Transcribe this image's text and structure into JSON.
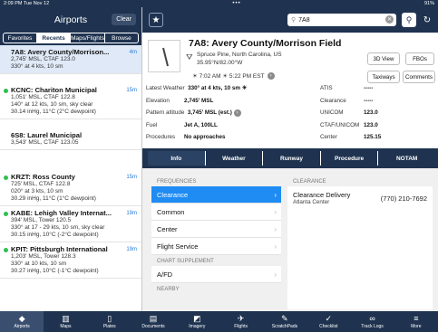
{
  "status": {
    "time": "2:09 PM  Tue Nov 12",
    "dots": "•••",
    "battery": "91%"
  },
  "left": {
    "title": "Airports",
    "clear_label": "Clear",
    "segments": [
      "Favorites",
      "Recents",
      "Maps/Flights",
      "Browse"
    ],
    "airports": [
      {
        "name": "7A8: Avery County/Morrison...",
        "dist": "4m",
        "l1": "2,745' MSL, CTAF 123.0",
        "l2": "330° at 4 kts, 10 sm",
        "l3": "",
        "l4": "",
        "dot": false,
        "selected": true
      },
      {
        "name": "KCNC: Chariton Municipal",
        "dist": "15m",
        "l1": "1,051' MSL, CTAF 122.8",
        "l2": "140° at 12 kts, 10 sm, sky clear",
        "l3": "30.14 inHg, 11°C (2°C dewpoint)",
        "l4": "",
        "dot": true,
        "selected": false
      },
      {
        "name": "6S8: Laurel Municipal",
        "dist": "",
        "l1": "3,543' MSL, CTAF 123.05",
        "l2": "",
        "l3": "",
        "l4": "",
        "dot": false,
        "selected": false
      },
      {
        "name": "KRZT: Ross County",
        "dist": "15m",
        "l1": "725' MSL, CTAF 122.8",
        "l2": "020° at 3 kts, 10 sm",
        "l3": "30.29 inHg, 11°C (1°C dewpoint)",
        "l4": "",
        "dot": true,
        "selected": false
      },
      {
        "name": "KABE: Lehigh Valley Internat...",
        "dist": "19m",
        "l1": "394' MSL, Tower 120.5",
        "l2": "330° at 17 - 29 kts, 10 sm, sky clear",
        "l3": "30.15 inHg, 10°C (-2°C dewpoint)",
        "l4": "",
        "dot": true,
        "selected": false
      },
      {
        "name": "KPIT: Pittsburgh International",
        "dist": "19m",
        "l1": "1,203' MSL, Tower 128.3",
        "l2": "330° at 10 kts, 10 sm",
        "l3": "30.27 inHg, 10°C (-1°C dewpoint)",
        "l4": "",
        "dot": true,
        "selected": false
      }
    ]
  },
  "right": {
    "search_value": "7A8",
    "title": "7A8: Avery County/Morrison Field",
    "location": "Spruce Pine, North Carolina, US",
    "coords": "35.95°N/82.00°W",
    "sun": "☀ 7:02 AM  ☀ 5:22 PM EST",
    "buttons": {
      "view3d": "3D View",
      "fbos": "FBOs",
      "taxiways": "Taxiways",
      "comments": "Comments"
    },
    "details_left": [
      {
        "k": "Latest Weather",
        "v": "330° at 4 kts, 10 sm ☀"
      },
      {
        "k": "Elevation",
        "v": "2,745' MSL"
      },
      {
        "k": "Pattern altitude",
        "v": "3,745' MSL (est.)"
      },
      {
        "k": "Fuel",
        "v": "Jet A, 100LL"
      },
      {
        "k": "Procedures",
        "v": "No approaches"
      }
    ],
    "details_right": [
      {
        "k": "ATIS",
        "v": "-----"
      },
      {
        "k": "Clearance",
        "v": "-----"
      },
      {
        "k": "UNICOM",
        "v": "123.0"
      },
      {
        "k": "CTAF/UNICOM",
        "v": "123.0"
      },
      {
        "k": "Center",
        "v": "125.15"
      }
    ],
    "tabs": [
      "Info",
      "Weather",
      "Runway",
      "Procedure",
      "NOTAM"
    ],
    "frequencies_header": "FREQUENCIES",
    "frequencies": [
      "Clearance",
      "Common",
      "Center",
      "Flight Service"
    ],
    "chart_supplement_header": "CHART SUPPLEMENT",
    "afd_label": "A/FD",
    "nearby_header": "NEARBY",
    "clearance_header": "CLEARANCE",
    "clearance_name": "Clearance Delivery",
    "clearance_sub": "Atlanta Center",
    "clearance_phone": "(770) 210-7692"
  },
  "nav": [
    {
      "label": "Airports",
      "icon": "◆"
    },
    {
      "label": "Maps",
      "icon": "▥"
    },
    {
      "label": "Plates",
      "icon": "▯"
    },
    {
      "label": "Documents",
      "icon": "▤"
    },
    {
      "label": "Imagery",
      "icon": "◩"
    },
    {
      "label": "Flights",
      "icon": "✈"
    },
    {
      "label": "ScratchPads",
      "icon": "✎"
    },
    {
      "label": "Checklist",
      "icon": "✓"
    },
    {
      "label": "Track Logs",
      "icon": "∞"
    },
    {
      "label": "More",
      "icon": "≡"
    }
  ],
  "colors": {
    "header": "#1f3350",
    "accent": "#1f8cf3",
    "dot": "#2ec04f"
  }
}
